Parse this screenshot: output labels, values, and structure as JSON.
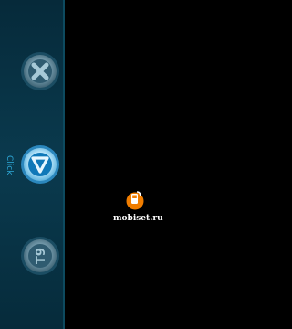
{
  "side_panel": {
    "label": "Click",
    "buttons": [
      {
        "icon": "close-icon"
      },
      {
        "icon": "triangle-down-icon"
      },
      {
        "icon": "t9-mode-icon",
        "text": "T9"
      }
    ]
  },
  "watermark": {
    "text": "mobiset.ru"
  },
  "colors": {
    "panel": "#0a3a4e",
    "accent": "#2ea7d6",
    "background": "#000000",
    "logo": "#f07d00"
  }
}
